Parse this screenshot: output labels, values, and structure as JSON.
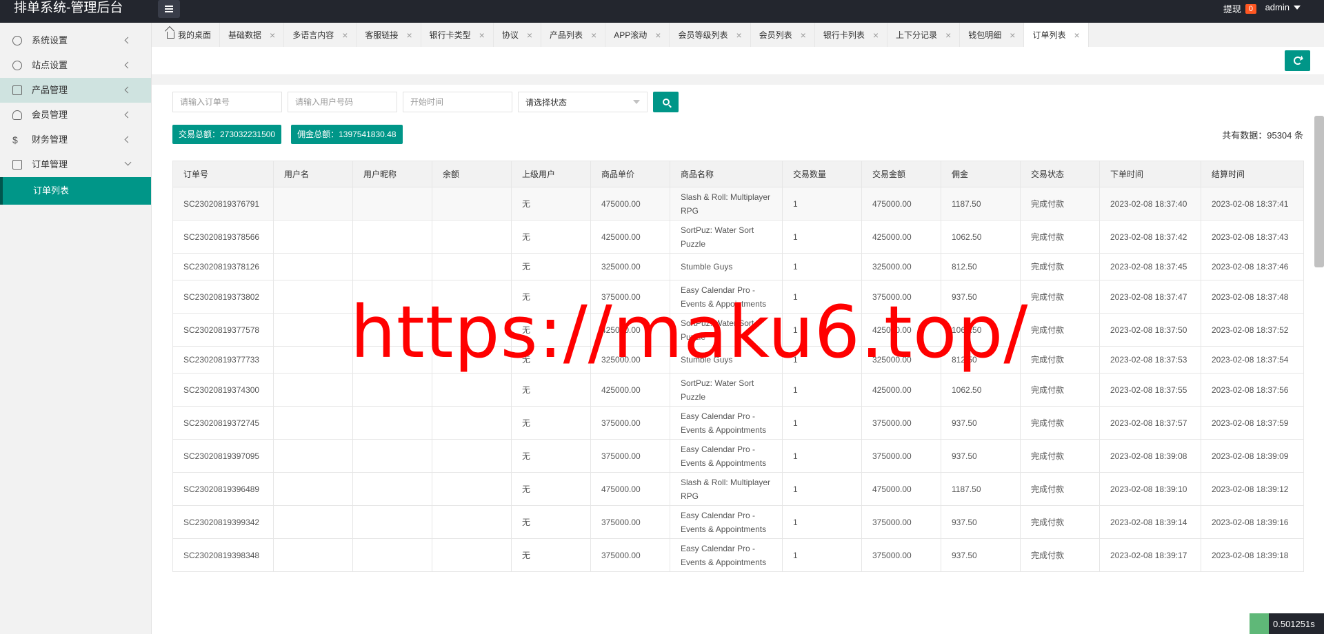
{
  "app": {
    "title": "排单系统-管理后台"
  },
  "header": {
    "withdraw_label": "提现",
    "withdraw_count": "0",
    "user": "admin"
  },
  "sidebar": {
    "items": [
      {
        "label": "系统设置"
      },
      {
        "label": "站点设置"
      },
      {
        "label": "产品管理"
      },
      {
        "label": "会员管理"
      },
      {
        "label": "财务管理"
      },
      {
        "label": "订单管理"
      }
    ],
    "sub_active": "订单列表"
  },
  "tabs": [
    "我的桌面",
    "基础数据",
    "多语言内容",
    "客服链接",
    "银行卡类型",
    "协议",
    "产品列表",
    "APP滚动",
    "会员等级列表",
    "会员列表",
    "银行卡列表",
    "上下分记录",
    "钱包明细",
    "订单列表"
  ],
  "filters": {
    "order_placeholder": "请输入订单号",
    "user_placeholder": "请输入用户号码",
    "start_placeholder": "开始时间",
    "status_select": "请选择状态"
  },
  "summary": {
    "trade_total": "交易总额：273032231500",
    "commission_total": "佣金总额：1397541830.48",
    "total_count": "共有数据：95304 条"
  },
  "table": {
    "headers": [
      "订单号",
      "用户名",
      "用户昵称",
      "余额",
      "上级用户",
      "商品单价",
      "商品名称",
      "交易数量",
      "交易金额",
      "佣金",
      "交易状态",
      "下单时间",
      "结算时间"
    ],
    "rows": [
      [
        "SC23020819376791",
        "",
        "",
        "",
        "无",
        "475000.00",
        "Slash & Roll: Multiplayer RPG",
        "1",
        "475000.00",
        "1187.50",
        "完成付款",
        "2023-02-08 18:37:40",
        "2023-02-08 18:37:41"
      ],
      [
        "SC23020819378566",
        "",
        "",
        "",
        "无",
        "425000.00",
        "SortPuz: Water Sort Puzzle",
        "1",
        "425000.00",
        "1062.50",
        "完成付款",
        "2023-02-08 18:37:42",
        "2023-02-08 18:37:43"
      ],
      [
        "SC23020819378126",
        "",
        "",
        "",
        "无",
        "325000.00",
        "Stumble Guys",
        "1",
        "325000.00",
        "812.50",
        "完成付款",
        "2023-02-08 18:37:45",
        "2023-02-08 18:37:46"
      ],
      [
        "SC23020819373802",
        "",
        "",
        "",
        "无",
        "375000.00",
        "Easy Calendar Pro - Events & Appointments",
        "1",
        "375000.00",
        "937.50",
        "完成付款",
        "2023-02-08 18:37:47",
        "2023-02-08 18:37:48"
      ],
      [
        "SC23020819377578",
        "",
        "",
        "",
        "无",
        "425000.00",
        "SortPuz: Water Sort Puzzle",
        "1",
        "425000.00",
        "1062.50",
        "完成付款",
        "2023-02-08 18:37:50",
        "2023-02-08 18:37:52"
      ],
      [
        "SC23020819377733",
        "",
        "",
        "",
        "无",
        "325000.00",
        "Stumble Guys",
        "1",
        "325000.00",
        "812.50",
        "完成付款",
        "2023-02-08 18:37:53",
        "2023-02-08 18:37:54"
      ],
      [
        "SC23020819374300",
        "",
        "",
        "",
        "无",
        "425000.00",
        "SortPuz: Water Sort Puzzle",
        "1",
        "425000.00",
        "1062.50",
        "完成付款",
        "2023-02-08 18:37:55",
        "2023-02-08 18:37:56"
      ],
      [
        "SC23020819372745",
        "",
        "",
        "",
        "无",
        "375000.00",
        "Easy Calendar Pro - Events & Appointments",
        "1",
        "375000.00",
        "937.50",
        "完成付款",
        "2023-02-08 18:37:57",
        "2023-02-08 18:37:59"
      ],
      [
        "SC23020819397095",
        "",
        "",
        "",
        "无",
        "375000.00",
        "Easy Calendar Pro - Events & Appointments",
        "1",
        "375000.00",
        "937.50",
        "完成付款",
        "2023-02-08 18:39:08",
        "2023-02-08 18:39:09"
      ],
      [
        "SC23020819396489",
        "",
        "",
        "",
        "无",
        "475000.00",
        "Slash & Roll: Multiplayer RPG",
        "1",
        "475000.00",
        "1187.50",
        "完成付款",
        "2023-02-08 18:39:10",
        "2023-02-08 18:39:12"
      ],
      [
        "SC23020819399342",
        "",
        "",
        "",
        "无",
        "375000.00",
        "Easy Calendar Pro - Events & Appointments",
        "1",
        "375000.00",
        "937.50",
        "完成付款",
        "2023-02-08 18:39:14",
        "2023-02-08 18:39:16"
      ],
      [
        "SC23020819398348",
        "",
        "",
        "",
        "无",
        "375000.00",
        "Easy Calendar Pro - Events & Appointments",
        "1",
        "375000.00",
        "937.50",
        "完成付款",
        "2023-02-08 18:39:17",
        "2023-02-08 18:39:18"
      ]
    ]
  },
  "watermark": "https://maku6.top/",
  "timer": "0.501251s"
}
